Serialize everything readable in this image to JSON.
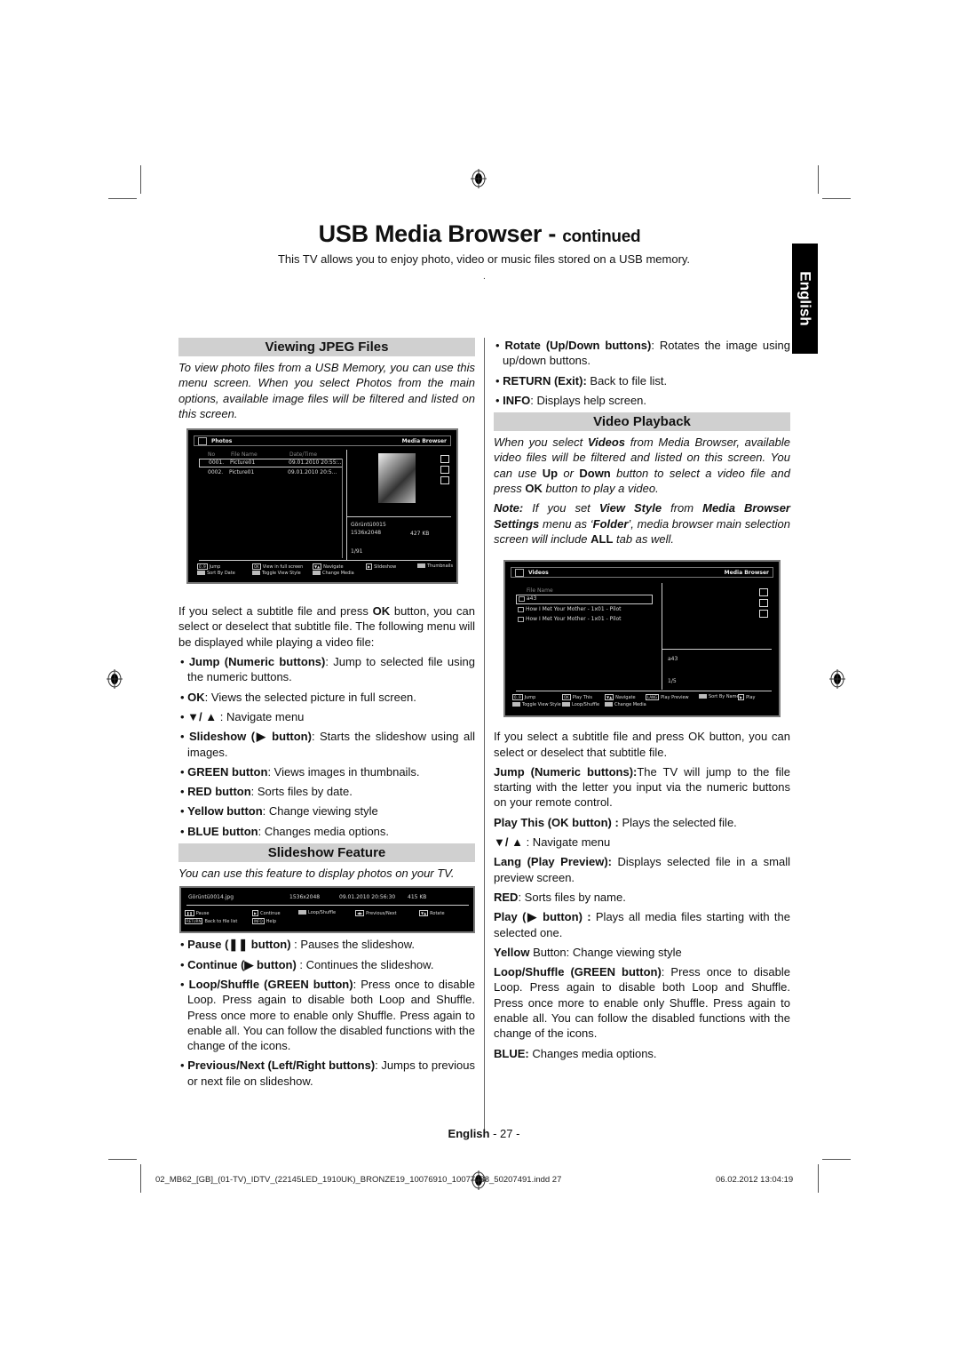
{
  "page": {
    "title_main": "USB Media Browser - ",
    "title_sub": "continued",
    "intro": "This TV allows you to enjoy photo, video or music files stored on a USB memory.",
    "intro_dot": ".",
    "language_tab": "English",
    "footer_language": "English",
    "footer_page": " - 27 -",
    "slug_file": "02_MB62_[GB]_(01-TV)_IDTV_(22145LED_1910UK)_BRONZE19_10076910_10077288_50207491.indd  27",
    "slug_date": "06.02.2012   13:04:19"
  },
  "left": {
    "jpeg_heading": "Viewing JPEG Files",
    "jpeg_intro": "To view photo files from a USB Memory, you can use this menu screen. When you select Photos from the main options, available image files will be filtered and listed on this screen.",
    "subtitle_para_a": "If you select a subtitle file and press ",
    "subtitle_para_ok": "OK",
    "subtitle_para_b": " button, you can select or deselect that subtitle file. The following menu will be displayed while playing a video file:",
    "bullets": [
      {
        "bold": "Jump (Numeric buttons)",
        "text": ": Jump to selected file using the numeric buttons."
      },
      {
        "bold": "OK",
        "text": ": Views the selected picture in full screen."
      },
      {
        "bold": "▼/ ▲",
        "text": " : Navigate menu"
      },
      {
        "bold": "Slideshow (▶ button)",
        "text": ": Starts the slideshow using all images."
      },
      {
        "bold": "GREEN button",
        "text": ": Views images in thumbnails."
      },
      {
        "bold": "RED button",
        "text": ": Sorts files by date."
      },
      {
        "bold": "Yellow button",
        "text": ": Change viewing style"
      },
      {
        "bold": "BLUE button",
        "text": ": Changes media options."
      }
    ],
    "slideshow_heading": "Slideshow Feature",
    "slideshow_intro": "You can use this feature to display photos on your TV.",
    "slideshow_bullets": [
      {
        "bold": "Pause (❚❚ button)",
        "text": " : Pauses the slideshow."
      },
      {
        "bold": "Continue (▶ button)",
        "text": " : Continues the slideshow."
      },
      {
        "bold": "Loop/Shuffle (GREEN button)",
        "text": ": Press once to disable Loop. Press again to disable both Loop and Shuffle. Press once more to enable only Shuffle. Press again to enable all. You can follow the disabled functions with the change of the icons."
      },
      {
        "bold": "Previous/Next (Left/Right buttons)",
        "text": ": Jumps to previous or next file on slideshow."
      }
    ]
  },
  "right": {
    "bullets": [
      {
        "bold": "Rotate (Up/Down buttons)",
        "text": ": Rotates the image using up/down buttons."
      },
      {
        "bold": "RETURN (Exit):",
        "text": " Back to file list."
      },
      {
        "bold": "INFO",
        "text": ": Displays help screen."
      }
    ],
    "video_heading": "Video Playback",
    "video_intro_1": "When you select ",
    "video_intro_b1": "Videos",
    "video_intro_2": " from Media Browser, available video files will be filtered and listed on this screen. You can use ",
    "video_intro_b2": "Up",
    "video_intro_3": " or ",
    "video_intro_b3": "Down",
    "video_intro_4": " button to select a video file and press ",
    "video_intro_b4": "OK",
    "video_intro_5": " button to play a video.",
    "note_b1": "Note:",
    "note_1": " If you set ",
    "note_b2": "View Style",
    "note_2": " from ",
    "note_b3": "Media Browser Settings",
    "note_3": " menu as ‘",
    "note_b4": "Folder",
    "note_4": "’, media browser main selection screen will include ",
    "note_b5": "ALL",
    "note_5": " tab as well.",
    "paras": [
      {
        "bold": "",
        "text": "If you select a subtitle file and press OK button, you can select or deselect that subtitle file."
      },
      {
        "bold": "Jump (Numeric buttons):",
        "text": "The TV will jump to the file starting with the letter you input via the numeric buttons on your remote control."
      },
      {
        "bold": "Play This (OK button) :",
        "text": " Plays the selected file."
      },
      {
        "bold": "▼/ ▲",
        "text": " : Navigate menu"
      },
      {
        "bold": "Lang (Play Preview):",
        "text": " Displays selected file in a small preview screen."
      },
      {
        "bold": "RED",
        "text": ": Sorts files by name."
      },
      {
        "bold": "Play (▶ button) :",
        "text": " Plays all media files starting with the selected one."
      },
      {
        "bold": "Yellow",
        "text": " Button: Change viewing style"
      },
      {
        "bold": "Loop/Shuffle (GREEN button)",
        "text": ": Press once to disable Loop. Press again to disable both Loop and Shuffle. Press once more to enable only Shuffle. Press again to enable all. You can follow the disabled functions with the change of the icons."
      },
      {
        "bold": "BLUE:",
        "text": " Changes media options."
      }
    ]
  },
  "photos_screen": {
    "title": "Photos",
    "brand": "Media Browser",
    "col_no": "No",
    "col_name": "File Name",
    "col_date": "Date/Time",
    "rows": [
      {
        "no": "0001.",
        "name": "Picture01",
        "date": "09.01.2010 20:55:.."
      },
      {
        "no": "0002.",
        "name": "Picture01",
        "date": "09.01.2010 20:5..."
      }
    ],
    "info_name": "Görüntü0015",
    "info_res": "1536x2048",
    "info_size": "427 KB",
    "counter": "1/91",
    "legend": [
      {
        "key": "0..9",
        "label": "Jump"
      },
      {
        "key": "OK",
        "label": "View in full screen"
      },
      {
        "key": "▼▲",
        "label": "Navigate"
      },
      {
        "key": "▶",
        "label": "Slideshow"
      },
      {
        "key": "",
        "label": "Thumbnails"
      },
      {
        "key": "",
        "label": "Sort By Date"
      },
      {
        "key": "",
        "label": "Toggle View Style"
      },
      {
        "key": "",
        "label": "Change Media"
      }
    ]
  },
  "slideshow_bar": {
    "file": "Görüntü0014.jpg",
    "res": "1536x2048",
    "date": "09.01.2010 20:56:30",
    "size": "415 KB",
    "legend": [
      {
        "key": "❚❚",
        "label": "Pause"
      },
      {
        "key": "▶",
        "label": "Continue"
      },
      {
        "key": "",
        "label": "Loop/Shuffle"
      },
      {
        "key": "◀▶",
        "label": "Previous/Next"
      },
      {
        "key": "▼▲",
        "label": "Rotate"
      },
      {
        "key": "RETURN",
        "label": "Back to file list"
      },
      {
        "key": "INFO",
        "label": "Help"
      }
    ]
  },
  "videos_screen": {
    "title": "Videos",
    "brand": "Media Browser",
    "col_name": "File Name",
    "rows": [
      {
        "name": "a43"
      },
      {
        "name": "How I Met Your Mother - 1x01 - Pilot"
      },
      {
        "name": "How I Met Your Mother - 1x01 - Pilot"
      }
    ],
    "info_name": "a43",
    "counter": "1/5",
    "legend": [
      {
        "key": "0..9",
        "label": "Jump"
      },
      {
        "key": "OK",
        "label": "Play This"
      },
      {
        "key": "▼▲",
        "label": "Navigate"
      },
      {
        "key": "LANG",
        "label": "Play Preview"
      },
      {
        "key": "",
        "label": "Sort By Name"
      },
      {
        "key": "▶",
        "label": "Play"
      },
      {
        "key": "",
        "label": "Toggle View Style"
      },
      {
        "key": "",
        "label": "Loop/Shuffle"
      },
      {
        "key": "",
        "label": "Change Media"
      }
    ]
  }
}
